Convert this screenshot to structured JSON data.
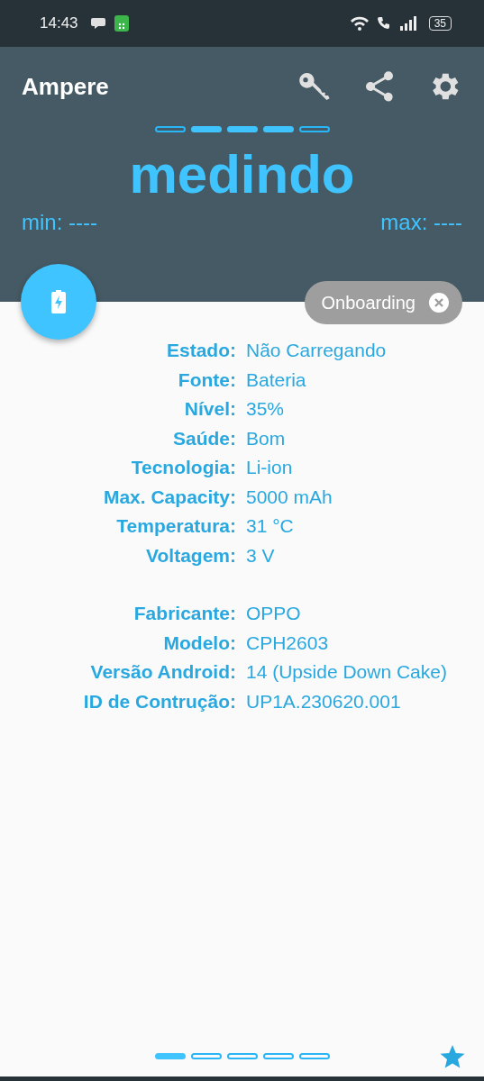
{
  "status_bar": {
    "time": "14:43",
    "battery": "35"
  },
  "app_bar": {
    "title": "Ampere"
  },
  "meter_segments": [
    {
      "on": false
    },
    {
      "on": true
    },
    {
      "on": true
    },
    {
      "on": true
    },
    {
      "on": false
    }
  ],
  "reading": "medindo",
  "min": "min: ----",
  "max": "max: ----",
  "chip": {
    "label": "Onboarding"
  },
  "info_groups": [
    [
      {
        "label": "Estado:",
        "value": "Não Carregando"
      },
      {
        "label": "Fonte:",
        "value": "Bateria"
      },
      {
        "label": "Nível:",
        "value": "35%"
      },
      {
        "label": "Saúde:",
        "value": "Bom"
      },
      {
        "label": "Tecnologia:",
        "value": "Li-ion"
      },
      {
        "label": "Max. Capacity:",
        "value": "5000 mAh"
      },
      {
        "label": "Temperatura:",
        "value": "31 °C"
      },
      {
        "label": "Voltagem:",
        "value": "3 V"
      }
    ],
    [
      {
        "label": "Fabricante:",
        "value": "OPPO"
      },
      {
        "label": "Modelo:",
        "value": "CPH2603"
      },
      {
        "label": "Versão Android:",
        "value": "14 (Upside Down Cake)"
      },
      {
        "label": "ID de Contrução:",
        "value": "UP1A.230620.001"
      }
    ]
  ],
  "pages": [
    {
      "selected": true
    },
    {
      "selected": false
    },
    {
      "selected": false
    },
    {
      "selected": false
    },
    {
      "selected": false
    }
  ]
}
